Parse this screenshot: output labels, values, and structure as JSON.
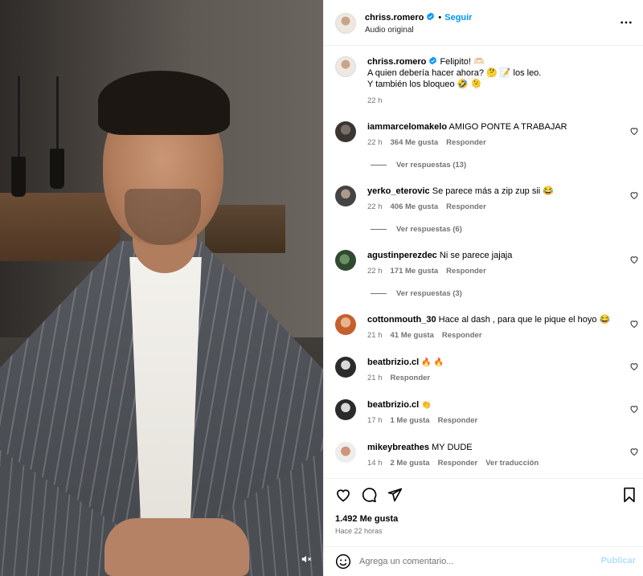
{
  "post": {
    "author": "chriss.romero",
    "audio": "Audio original",
    "follow_label": "Seguir",
    "dot": "•"
  },
  "caption": {
    "author": "chriss.romero",
    "line1": "Felipito! 🫶🏻",
    "line2": "A quien debería hacer ahora? 🤔 📝 los leo.",
    "line3": "Y también los bloqueo 🤣 🫠",
    "time": "22 h"
  },
  "comments": [
    {
      "user": "iammarcelomakelo",
      "text": "AMIGO PONTE A TRABAJAR",
      "time": "22 h",
      "likes": "364 Me gusta",
      "reply": "Responder",
      "replies": "Ver respuestas (13)"
    },
    {
      "user": "yerko_eterovic",
      "text": "Se parece más a zip zup sii 😂",
      "time": "22 h",
      "likes": "406 Me gusta",
      "reply": "Responder",
      "replies": "Ver respuestas (6)"
    },
    {
      "user": "agustinperezdec",
      "text": "Ni se parece jajaja",
      "time": "22 h",
      "likes": "171 Me gusta",
      "reply": "Responder",
      "replies": "Ver respuestas (3)"
    },
    {
      "user": "cottonmouth_30",
      "text": "Hace al dash , para que le pique el hoyo 😂",
      "time": "21 h",
      "likes": "41 Me gusta",
      "reply": "Responder"
    },
    {
      "user": "beatbrizio.cl",
      "text": "🔥 🔥",
      "time": "21 h",
      "reply": "Responder"
    },
    {
      "user": "beatbrizio.cl",
      "text": "👏",
      "time": "17 h",
      "likes": "1 Me gusta",
      "reply": "Responder"
    },
    {
      "user": "mikeybreathes",
      "text": "MY DUDE",
      "time": "14 h",
      "likes": "2 Me gusta",
      "reply": "Responder",
      "translate": "Ver traducción"
    }
  ],
  "footer": {
    "likes": "1.492 Me gusta",
    "date": "Hace 22 horas",
    "comment_placeholder": "Agrega un comentario...",
    "publish": "Publicar"
  },
  "icons": {
    "verified": "verified-badge-icon",
    "more": "more-options-icon",
    "heart": "heart-icon",
    "comment": "comment-icon",
    "share": "share-icon",
    "save": "bookmark-icon",
    "emoji": "emoji-icon",
    "mute": "muted-speaker-icon"
  },
  "colors": {
    "accent": "#0095f6",
    "publish_disabled": "#b2dffc",
    "secondary_text": "#737373"
  }
}
